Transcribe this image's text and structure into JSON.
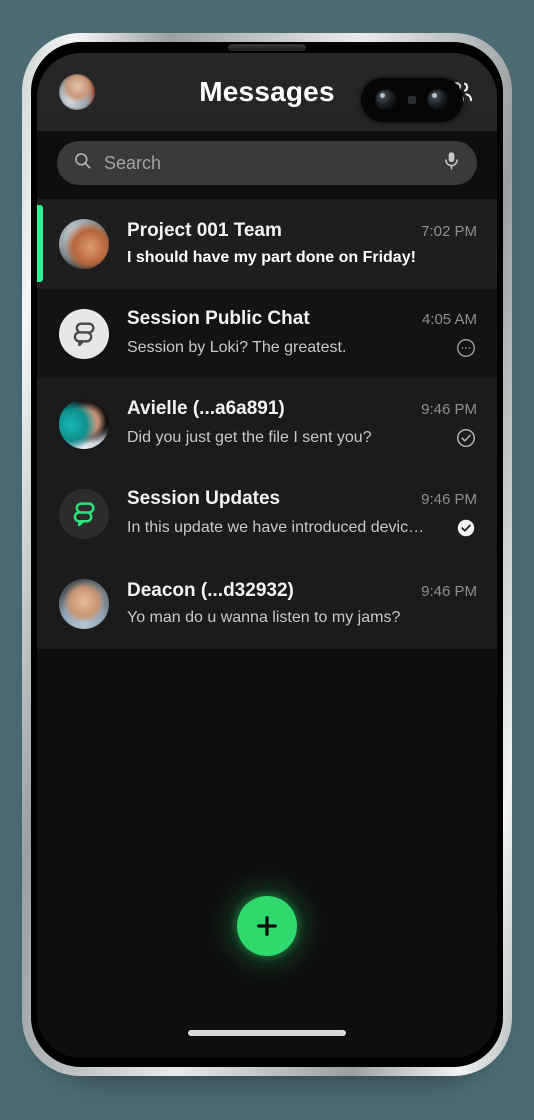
{
  "app": {
    "title": "Messages",
    "accent_green": "#31f093",
    "fab_green": "#2fd96e",
    "screen_bg": "#0e0e0e",
    "device_bg": "#4c6b73"
  },
  "header": {
    "title": "Messages",
    "avatar_name": "profile-avatar",
    "globe_icon": "globe-icon",
    "group_icon": "people-group-icon"
  },
  "search": {
    "placeholder": "Search",
    "value": "",
    "search_icon": "search-icon",
    "mic_icon": "microphone-icon"
  },
  "conversations": [
    {
      "name": "Project 001 Team",
      "time": "7:02 PM",
      "snippet": "I should have my part done on Friday!",
      "unread": true,
      "avatar_type": "photo-group",
      "status": "none"
    },
    {
      "name": "Session Public Chat",
      "time": "4:05 AM",
      "snippet": "Session by Loki? The greatest.",
      "unread": false,
      "avatar_type": "session-logo-light",
      "status": "sending"
    },
    {
      "name": "Avielle (...a6a891)",
      "time": "9:46 PM",
      "snippet": "Did you just get the file I sent you?",
      "unread": false,
      "avatar_type": "photo-woman",
      "status": "sent"
    },
    {
      "name": "Session Updates",
      "time": "9:46 PM",
      "snippet": "In this update we have introduced device...",
      "unread": false,
      "avatar_type": "session-logo-green",
      "status": "read"
    },
    {
      "name": "Deacon (...d32932)",
      "time": "9:46 PM",
      "snippet": "Yo man do u wanna listen to my jams?",
      "unread": false,
      "avatar_type": "photo-man",
      "status": "none"
    }
  ],
  "fab": {
    "label": "+",
    "icon": "plus-icon"
  },
  "system": {
    "home_indicator": "home-indicator",
    "front_camera": "front-camera",
    "earpiece_speaker": "earpiece-speaker"
  }
}
